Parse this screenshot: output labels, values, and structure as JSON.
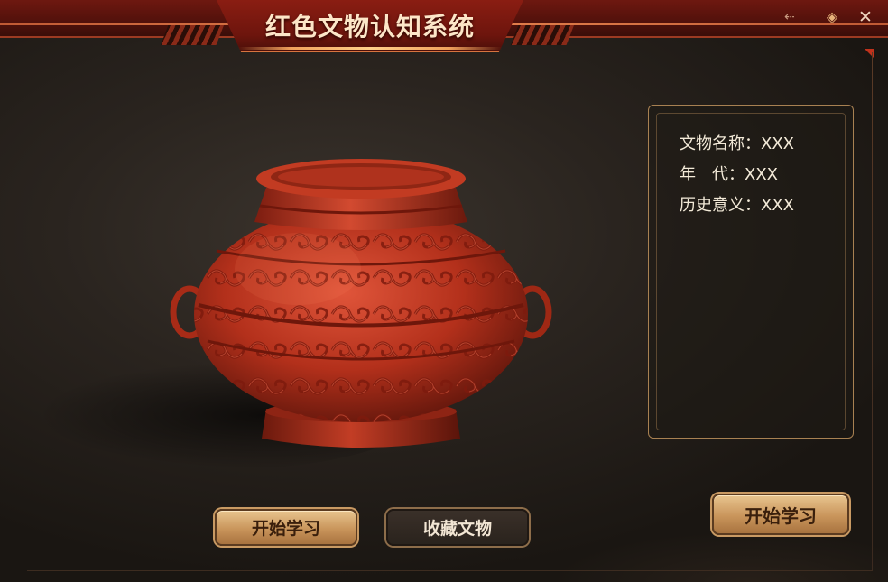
{
  "app": {
    "title": "红色文物认知系统"
  },
  "window_controls": {
    "back_icon": "arrow-left-icon",
    "pin_icon": "diamond-icon",
    "close_icon": "close-icon",
    "back_glyph": "⇠",
    "pin_glyph": "◈",
    "close_glyph": "✕"
  },
  "artifact": {
    "image_semantic": "red-lacquer-bronze-style-jar",
    "info": {
      "name_label": "文物名称：",
      "name_value": "XXX",
      "era_label": "年　代：",
      "era_value": "XXX",
      "significance_label": "历史意义：",
      "significance_value": "XXX"
    }
  },
  "buttons": {
    "start_learning": "开始学习",
    "collect_artifact": "收藏文物",
    "start_learning_side": "开始学习"
  },
  "colors": {
    "banner_red": "#6e1810",
    "accent_gold": "#c9955b",
    "artifact_red": "#c2341d",
    "background": "#2a241f"
  }
}
